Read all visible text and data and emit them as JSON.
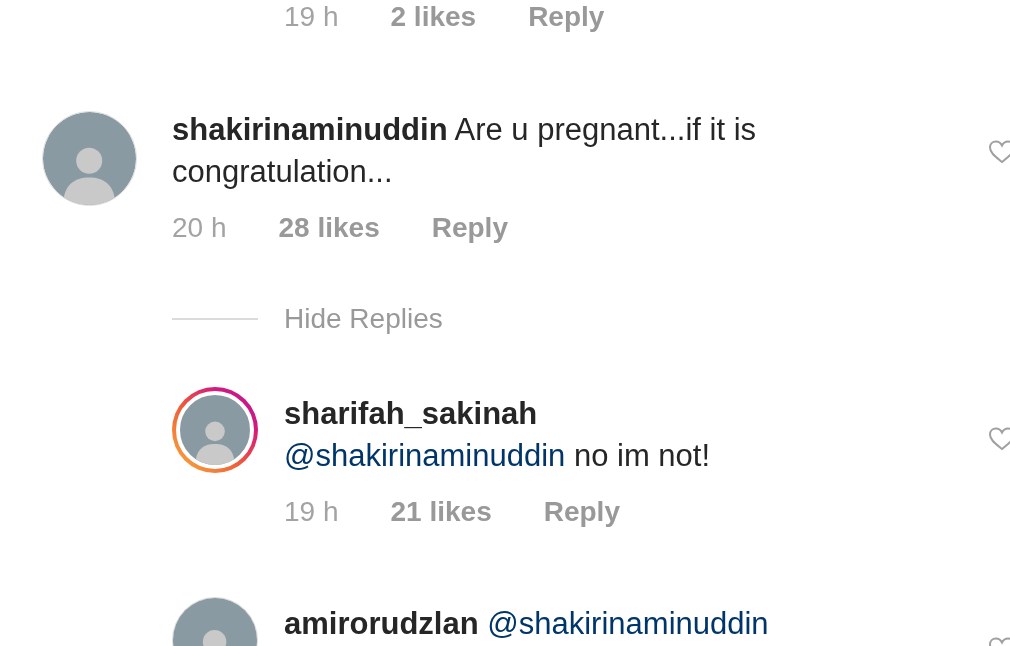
{
  "previous_comment": {
    "time": "19 h",
    "likes": "2 likes",
    "reply": "Reply"
  },
  "comment": {
    "username": "shakirinaminuddin",
    "text": "Are u pregnant...if it is congratulation...",
    "time": "20 h",
    "likes": "28 likes",
    "reply": "Reply"
  },
  "hide_replies": "Hide Replies",
  "replies": [
    {
      "username": "sharifah_sakinah",
      "story_ring": true,
      "mention": "@shakirinaminuddin",
      "text": "no im not!",
      "time": "19 h",
      "likes": "21 likes",
      "reply": "Reply"
    },
    {
      "username": "amirorudzlan",
      "story_ring": false,
      "mention": "@shakirinaminuddin"
    }
  ]
}
